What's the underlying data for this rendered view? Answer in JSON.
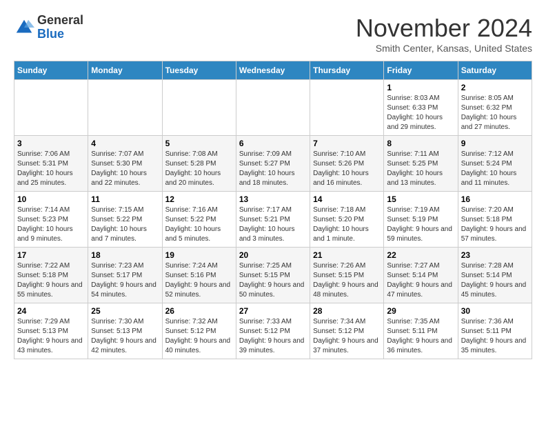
{
  "header": {
    "logo_general": "General",
    "logo_blue": "Blue",
    "month_title": "November 2024",
    "location": "Smith Center, Kansas, United States"
  },
  "days_of_week": [
    "Sunday",
    "Monday",
    "Tuesday",
    "Wednesday",
    "Thursday",
    "Friday",
    "Saturday"
  ],
  "weeks": [
    [
      {
        "day": "",
        "info": ""
      },
      {
        "day": "",
        "info": ""
      },
      {
        "day": "",
        "info": ""
      },
      {
        "day": "",
        "info": ""
      },
      {
        "day": "",
        "info": ""
      },
      {
        "day": "1",
        "info": "Sunrise: 8:03 AM\nSunset: 6:33 PM\nDaylight: 10 hours and 29 minutes."
      },
      {
        "day": "2",
        "info": "Sunrise: 8:05 AM\nSunset: 6:32 PM\nDaylight: 10 hours and 27 minutes."
      }
    ],
    [
      {
        "day": "3",
        "info": "Sunrise: 7:06 AM\nSunset: 5:31 PM\nDaylight: 10 hours and 25 minutes."
      },
      {
        "day": "4",
        "info": "Sunrise: 7:07 AM\nSunset: 5:30 PM\nDaylight: 10 hours and 22 minutes."
      },
      {
        "day": "5",
        "info": "Sunrise: 7:08 AM\nSunset: 5:28 PM\nDaylight: 10 hours and 20 minutes."
      },
      {
        "day": "6",
        "info": "Sunrise: 7:09 AM\nSunset: 5:27 PM\nDaylight: 10 hours and 18 minutes."
      },
      {
        "day": "7",
        "info": "Sunrise: 7:10 AM\nSunset: 5:26 PM\nDaylight: 10 hours and 16 minutes."
      },
      {
        "day": "8",
        "info": "Sunrise: 7:11 AM\nSunset: 5:25 PM\nDaylight: 10 hours and 13 minutes."
      },
      {
        "day": "9",
        "info": "Sunrise: 7:12 AM\nSunset: 5:24 PM\nDaylight: 10 hours and 11 minutes."
      }
    ],
    [
      {
        "day": "10",
        "info": "Sunrise: 7:14 AM\nSunset: 5:23 PM\nDaylight: 10 hours and 9 minutes."
      },
      {
        "day": "11",
        "info": "Sunrise: 7:15 AM\nSunset: 5:22 PM\nDaylight: 10 hours and 7 minutes."
      },
      {
        "day": "12",
        "info": "Sunrise: 7:16 AM\nSunset: 5:22 PM\nDaylight: 10 hours and 5 minutes."
      },
      {
        "day": "13",
        "info": "Sunrise: 7:17 AM\nSunset: 5:21 PM\nDaylight: 10 hours and 3 minutes."
      },
      {
        "day": "14",
        "info": "Sunrise: 7:18 AM\nSunset: 5:20 PM\nDaylight: 10 hours and 1 minute."
      },
      {
        "day": "15",
        "info": "Sunrise: 7:19 AM\nSunset: 5:19 PM\nDaylight: 9 hours and 59 minutes."
      },
      {
        "day": "16",
        "info": "Sunrise: 7:20 AM\nSunset: 5:18 PM\nDaylight: 9 hours and 57 minutes."
      }
    ],
    [
      {
        "day": "17",
        "info": "Sunrise: 7:22 AM\nSunset: 5:18 PM\nDaylight: 9 hours and 55 minutes."
      },
      {
        "day": "18",
        "info": "Sunrise: 7:23 AM\nSunset: 5:17 PM\nDaylight: 9 hours and 54 minutes."
      },
      {
        "day": "19",
        "info": "Sunrise: 7:24 AM\nSunset: 5:16 PM\nDaylight: 9 hours and 52 minutes."
      },
      {
        "day": "20",
        "info": "Sunrise: 7:25 AM\nSunset: 5:15 PM\nDaylight: 9 hours and 50 minutes."
      },
      {
        "day": "21",
        "info": "Sunrise: 7:26 AM\nSunset: 5:15 PM\nDaylight: 9 hours and 48 minutes."
      },
      {
        "day": "22",
        "info": "Sunrise: 7:27 AM\nSunset: 5:14 PM\nDaylight: 9 hours and 47 minutes."
      },
      {
        "day": "23",
        "info": "Sunrise: 7:28 AM\nSunset: 5:14 PM\nDaylight: 9 hours and 45 minutes."
      }
    ],
    [
      {
        "day": "24",
        "info": "Sunrise: 7:29 AM\nSunset: 5:13 PM\nDaylight: 9 hours and 43 minutes."
      },
      {
        "day": "25",
        "info": "Sunrise: 7:30 AM\nSunset: 5:13 PM\nDaylight: 9 hours and 42 minutes."
      },
      {
        "day": "26",
        "info": "Sunrise: 7:32 AM\nSunset: 5:12 PM\nDaylight: 9 hours and 40 minutes."
      },
      {
        "day": "27",
        "info": "Sunrise: 7:33 AM\nSunset: 5:12 PM\nDaylight: 9 hours and 39 minutes."
      },
      {
        "day": "28",
        "info": "Sunrise: 7:34 AM\nSunset: 5:12 PM\nDaylight: 9 hours and 37 minutes."
      },
      {
        "day": "29",
        "info": "Sunrise: 7:35 AM\nSunset: 5:11 PM\nDaylight: 9 hours and 36 minutes."
      },
      {
        "day": "30",
        "info": "Sunrise: 7:36 AM\nSunset: 5:11 PM\nDaylight: 9 hours and 35 minutes."
      }
    ]
  ]
}
